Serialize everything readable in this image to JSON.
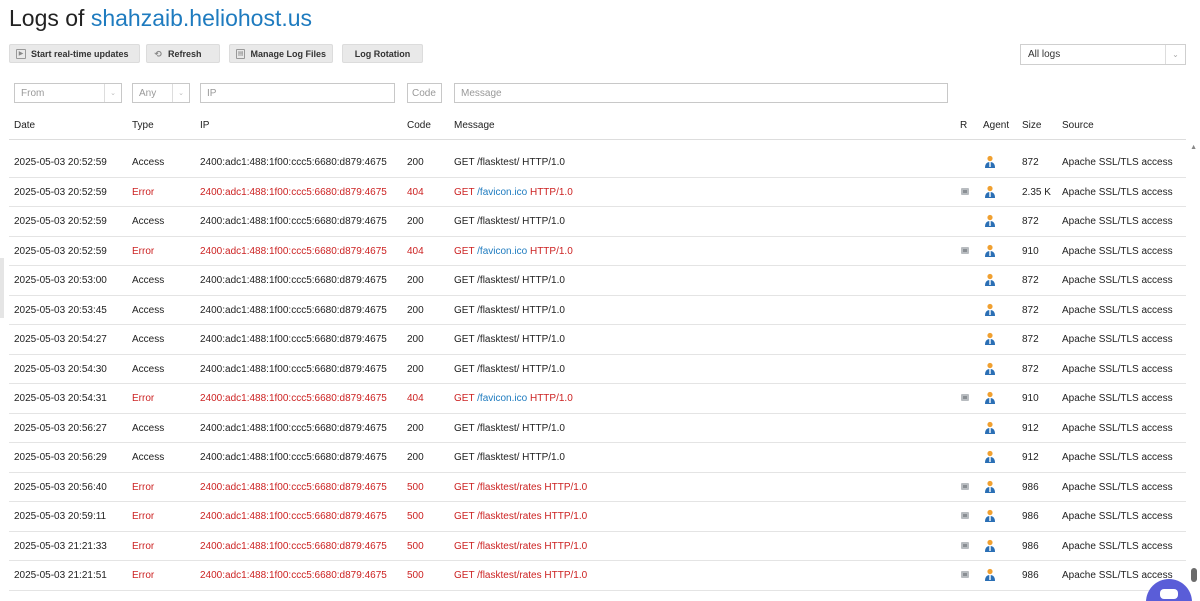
{
  "page": {
    "title_prefix": "Logs of",
    "domain": "shahzaib.heliohost.us"
  },
  "toolbar": {
    "realtime_label": "Start real-time updates",
    "refresh_label": "Refresh",
    "manage_label": "Manage Log Files",
    "rotation_label": "Log Rotation"
  },
  "log_select": {
    "value": "All logs"
  },
  "filters": {
    "from": "From",
    "type": "Any",
    "ip_placeholder": "IP",
    "code_placeholder": "Code",
    "message_placeholder": "Message"
  },
  "columns": {
    "date": "Date",
    "type": "Type",
    "ip": "IP",
    "code": "Code",
    "message": "Message",
    "r": "R",
    "agent": "Agent",
    "size": "Size",
    "source": "Source"
  },
  "colors": {
    "accent": "#1e7bbf",
    "error": "#cc2222"
  },
  "rows": [
    {
      "date": "2025-05-03 20:52:59",
      "type": "Access",
      "ip": "2400:adc1:488:1f00:ccc5:6680:d879:4675",
      "code": "200",
      "msg_pre": "GET /flasktest/ HTTP/1.0",
      "msg_link": "",
      "msg_post": "",
      "r": false,
      "size": "872",
      "source": "Apache SSL/TLS access",
      "error": false
    },
    {
      "date": "2025-05-03 20:52:59",
      "type": "Error",
      "ip": "2400:adc1:488:1f00:ccc5:6680:d879:4675",
      "code": "404",
      "msg_pre": "GET ",
      "msg_link": "/favicon.ico",
      "msg_post": " HTTP/1.0",
      "r": true,
      "size": "2.35 K",
      "source": "Apache SSL/TLS access",
      "error": true
    },
    {
      "date": "2025-05-03 20:52:59",
      "type": "Access",
      "ip": "2400:adc1:488:1f00:ccc5:6680:d879:4675",
      "code": "200",
      "msg_pre": "GET /flasktest/ HTTP/1.0",
      "msg_link": "",
      "msg_post": "",
      "r": false,
      "size": "872",
      "source": "Apache SSL/TLS access",
      "error": false
    },
    {
      "date": "2025-05-03 20:52:59",
      "type": "Error",
      "ip": "2400:adc1:488:1f00:ccc5:6680:d879:4675",
      "code": "404",
      "msg_pre": "GET ",
      "msg_link": "/favicon.ico",
      "msg_post": " HTTP/1.0",
      "r": true,
      "size": "910",
      "source": "Apache SSL/TLS access",
      "error": true
    },
    {
      "date": "2025-05-03 20:53:00",
      "type": "Access",
      "ip": "2400:adc1:488:1f00:ccc5:6680:d879:4675",
      "code": "200",
      "msg_pre": "GET /flasktest/ HTTP/1.0",
      "msg_link": "",
      "msg_post": "",
      "r": false,
      "size": "872",
      "source": "Apache SSL/TLS access",
      "error": false
    },
    {
      "date": "2025-05-03 20:53:45",
      "type": "Access",
      "ip": "2400:adc1:488:1f00:ccc5:6680:d879:4675",
      "code": "200",
      "msg_pre": "GET /flasktest/ HTTP/1.0",
      "msg_link": "",
      "msg_post": "",
      "r": false,
      "size": "872",
      "source": "Apache SSL/TLS access",
      "error": false
    },
    {
      "date": "2025-05-03 20:54:27",
      "type": "Access",
      "ip": "2400:adc1:488:1f00:ccc5:6680:d879:4675",
      "code": "200",
      "msg_pre": "GET /flasktest/ HTTP/1.0",
      "msg_link": "",
      "msg_post": "",
      "r": false,
      "size": "872",
      "source": "Apache SSL/TLS access",
      "error": false
    },
    {
      "date": "2025-05-03 20:54:30",
      "type": "Access",
      "ip": "2400:adc1:488:1f00:ccc5:6680:d879:4675",
      "code": "200",
      "msg_pre": "GET /flasktest/ HTTP/1.0",
      "msg_link": "",
      "msg_post": "",
      "r": false,
      "size": "872",
      "source": "Apache SSL/TLS access",
      "error": false
    },
    {
      "date": "2025-05-03 20:54:31",
      "type": "Error",
      "ip": "2400:adc1:488:1f00:ccc5:6680:d879:4675",
      "code": "404",
      "msg_pre": "GET ",
      "msg_link": "/favicon.ico",
      "msg_post": " HTTP/1.0",
      "r": true,
      "size": "910",
      "source": "Apache SSL/TLS access",
      "error": true
    },
    {
      "date": "2025-05-03 20:56:27",
      "type": "Access",
      "ip": "2400:adc1:488:1f00:ccc5:6680:d879:4675",
      "code": "200",
      "msg_pre": "GET /flasktest/ HTTP/1.0",
      "msg_link": "",
      "msg_post": "",
      "r": false,
      "size": "912",
      "source": "Apache SSL/TLS access",
      "error": false
    },
    {
      "date": "2025-05-03 20:56:29",
      "type": "Access",
      "ip": "2400:adc1:488:1f00:ccc5:6680:d879:4675",
      "code": "200",
      "msg_pre": "GET /flasktest/ HTTP/1.0",
      "msg_link": "",
      "msg_post": "",
      "r": false,
      "size": "912",
      "source": "Apache SSL/TLS access",
      "error": false
    },
    {
      "date": "2025-05-03 20:56:40",
      "type": "Error",
      "ip": "2400:adc1:488:1f00:ccc5:6680:d879:4675",
      "code": "500",
      "msg_pre": "GET /flasktest/rates HTTP/1.0",
      "msg_link": "",
      "msg_post": "",
      "r": true,
      "size": "986",
      "source": "Apache SSL/TLS access",
      "error": true
    },
    {
      "date": "2025-05-03 20:59:11",
      "type": "Error",
      "ip": "2400:adc1:488:1f00:ccc5:6680:d879:4675",
      "code": "500",
      "msg_pre": "GET /flasktest/rates HTTP/1.0",
      "msg_link": "",
      "msg_post": "",
      "r": true,
      "size": "986",
      "source": "Apache SSL/TLS access",
      "error": true
    },
    {
      "date": "2025-05-03 21:21:33",
      "type": "Error",
      "ip": "2400:adc1:488:1f00:ccc5:6680:d879:4675",
      "code": "500",
      "msg_pre": "GET /flasktest/rates HTTP/1.0",
      "msg_link": "",
      "msg_post": "",
      "r": true,
      "size": "986",
      "source": "Apache SSL/TLS access",
      "error": true
    },
    {
      "date": "2025-05-03 21:21:51",
      "type": "Error",
      "ip": "2400:adc1:488:1f00:ccc5:6680:d879:4675",
      "code": "500",
      "msg_pre": "GET /flasktest/rates HTTP/1.0",
      "msg_link": "",
      "msg_post": "",
      "r": true,
      "size": "986",
      "source": "Apache SSL/TLS access",
      "error": true
    }
  ]
}
